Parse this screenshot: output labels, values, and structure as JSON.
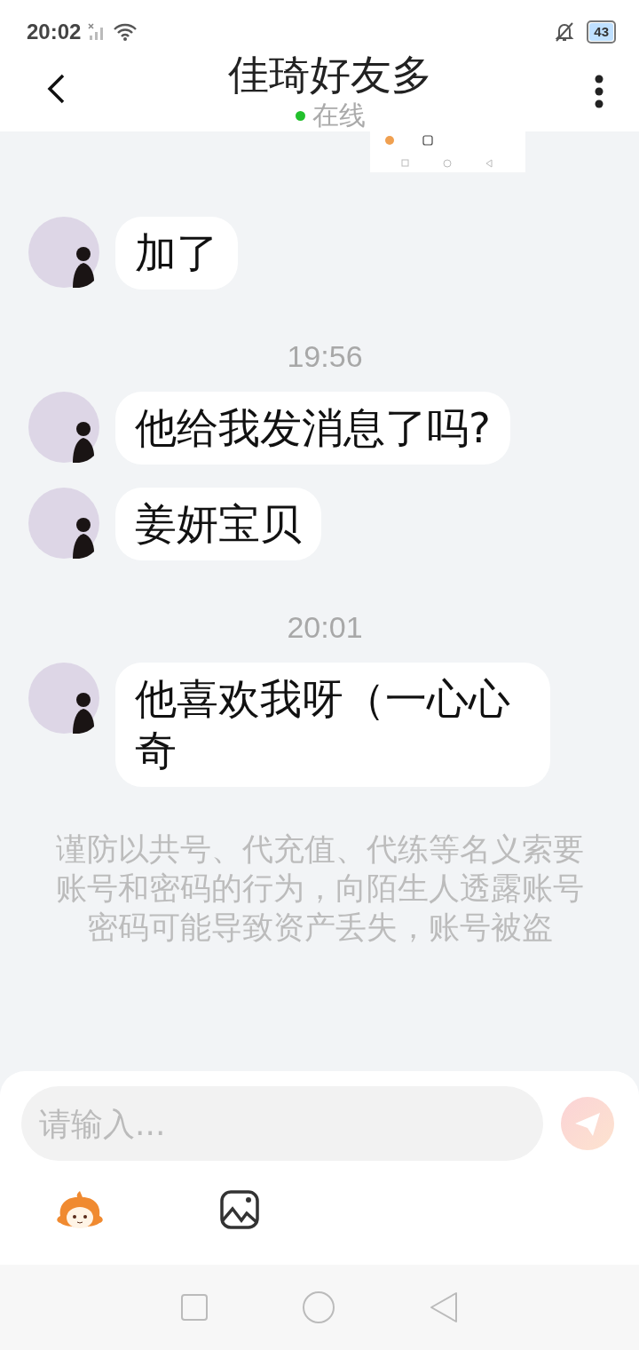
{
  "status_bar": {
    "time": "20:02",
    "battery": "43"
  },
  "header": {
    "title": "佳琦好友多",
    "presence": "在线",
    "online": true
  },
  "messages": [
    {
      "kind": "message",
      "text": "加了"
    },
    {
      "kind": "time",
      "text": "19:56"
    },
    {
      "kind": "message",
      "text": "他给我发消息了吗?"
    },
    {
      "kind": "message",
      "text": "姜妍宝贝"
    },
    {
      "kind": "time",
      "text": "20:01"
    },
    {
      "kind": "message",
      "text": "他喜欢我呀（一心心奇"
    }
  ],
  "notice": "谨防以共号、代充值、代练等名义索要账号和密码的行为，向陌生人透露账号密码可能导致资产丢失，账号被盗",
  "composer": {
    "placeholder": "请输入..."
  }
}
